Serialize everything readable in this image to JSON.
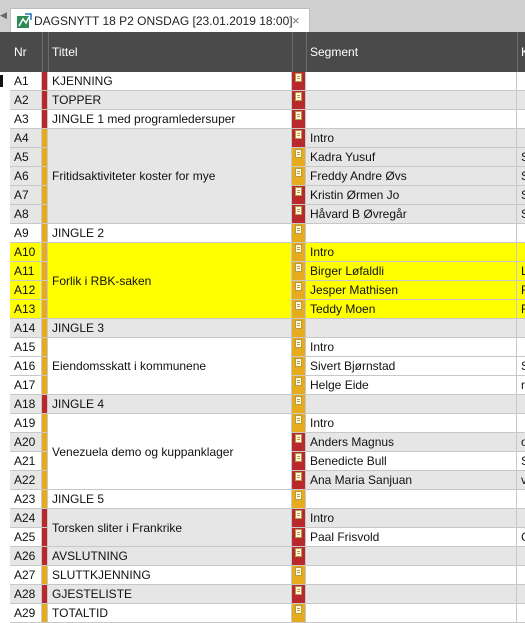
{
  "tab": {
    "title": "DAGSNYTT 18 P2 ONSDAG [23.01.2019 18:00]",
    "close": "×",
    "left_glyph": "◀"
  },
  "columns": {
    "nr": "Nr",
    "title": "Tittel",
    "segment": "Segment",
    "extra": "K"
  },
  "colors": {
    "red": "#b8282c",
    "yellow": "#e6ac1e",
    "highlight": "#ffff00",
    "header": "#4a4a4a",
    "alt": "#e6e6e6"
  },
  "rows": [
    {
      "nr": "A1",
      "title": "KJENNING",
      "segment": "",
      "ext": "",
      "bg": "#ffffff",
      "stripe": "#b8282c",
      "seg_stripe": "#b8282c"
    },
    {
      "nr": "A2",
      "title": "TOPPER",
      "segment": "",
      "ext": "",
      "bg": "#e6e6e6",
      "stripe": "#b8282c",
      "seg_stripe": "#b8282c"
    },
    {
      "nr": "A3",
      "title": "JINGLE 1 med programledersuper",
      "segment": "",
      "ext": "",
      "bg": "#ffffff",
      "stripe": "#b8282c",
      "seg_stripe": "#b8282c"
    },
    {
      "nr": "A4",
      "title": "",
      "segment": "Intro",
      "ext": "",
      "bg": "#e6e6e6",
      "stripe": "#e6ac1e",
      "seg_stripe": "#b8282c"
    },
    {
      "nr": "A5",
      "title": "",
      "segment": "Kadra Yusuf",
      "ext": "S",
      "bg": "#e6e6e6",
      "stripe": "#e6ac1e",
      "seg_stripe": "#e6ac1e"
    },
    {
      "nr": "A6",
      "title": "",
      "segment": "Freddy Andre Øvs",
      "ext": "S",
      "bg": "#e6e6e6",
      "stripe": "#e6ac1e",
      "seg_stripe": "#e6ac1e"
    },
    {
      "nr": "A7",
      "title": "",
      "segment": "Kristin Ørmen Jo",
      "ext": "S",
      "bg": "#e6e6e6",
      "stripe": "#e6ac1e",
      "seg_stripe": "#b8282c"
    },
    {
      "nr": "A8",
      "title": "",
      "segment": "Håvard B Øvregår",
      "ext": "S",
      "bg": "#e6e6e6",
      "stripe": "#e6ac1e",
      "seg_stripe": "#b8282c"
    },
    {
      "nr": "A9",
      "title": "JINGLE 2",
      "segment": "",
      "ext": "",
      "bg": "#ffffff",
      "stripe": "#e6ac1e",
      "seg_stripe": "#e6ac1e"
    },
    {
      "nr": "A10",
      "title": "",
      "segment": "Intro",
      "ext": "",
      "bg": "#ffff00",
      "stripe": "#e6ac1e",
      "seg_stripe": "#e6ac1e"
    },
    {
      "nr": "A11",
      "title": "",
      "segment": "Birger Løfaldli",
      "ext": "L",
      "bg": "#ffff00",
      "stripe": "#e6ac1e",
      "seg_stripe": "#e6ac1e"
    },
    {
      "nr": "A12",
      "title": "",
      "segment": "Jesper Mathisen",
      "ext": "R",
      "bg": "#ffff00",
      "stripe": "#e6ac1e",
      "seg_stripe": "#e6ac1e"
    },
    {
      "nr": "A13",
      "title": "",
      "segment": "Teddy Moen",
      "ext": "R",
      "bg": "#ffff00",
      "stripe": "#e6ac1e",
      "seg_stripe": "#e6ac1e"
    },
    {
      "nr": "A14",
      "title": "JINGLE 3",
      "segment": "",
      "ext": "",
      "bg": "#e6e6e6",
      "stripe": "#e6ac1e",
      "seg_stripe": "#e6ac1e"
    },
    {
      "nr": "A15",
      "title": "",
      "segment": "Intro",
      "ext": "",
      "bg": "#ffffff",
      "stripe": "#e6ac1e",
      "seg_stripe": "#e6ac1e"
    },
    {
      "nr": "A16",
      "title": "",
      "segment": "Sivert Bjørnstad",
      "ext": "S",
      "bg": "#ffffff",
      "stripe": "#e6ac1e",
      "seg_stripe": "#e6ac1e"
    },
    {
      "nr": "A17",
      "title": "",
      "segment": "Helge Eide",
      "ext": "re",
      "bg": "#ffffff",
      "stripe": "#e6ac1e",
      "seg_stripe": "#e6ac1e"
    },
    {
      "nr": "A18",
      "title": "JINGLE 4",
      "segment": "",
      "ext": "",
      "bg": "#e6e6e6",
      "stripe": "#b8282c",
      "seg_stripe": "#e6ac1e"
    },
    {
      "nr": "A19",
      "title": "",
      "segment": "Intro",
      "ext": "",
      "bg": "#ffffff",
      "stripe": "#e6ac1e",
      "seg_stripe": "#e6ac1e"
    },
    {
      "nr": "A20",
      "title": "",
      "segment": "Anders Magnus",
      "ext": "o",
      "bg": "#e6e6e6",
      "stripe": "#e6ac1e",
      "seg_stripe": "#b8282c"
    },
    {
      "nr": "A21",
      "title": "",
      "segment": "Benedicte Bull",
      "ext": "S",
      "bg": "#ffffff",
      "stripe": "#e6ac1e",
      "seg_stripe": "#b8282c"
    },
    {
      "nr": "A22",
      "title": "",
      "segment": "Ana Maria Sanjuan",
      "ext": "v",
      "bg": "#e6e6e6",
      "stripe": "#e6ac1e",
      "seg_stripe": "#b8282c"
    },
    {
      "nr": "A23",
      "title": "JINGLE 5",
      "segment": "",
      "ext": "",
      "bg": "#ffffff",
      "stripe": "#e6ac1e",
      "seg_stripe": "#e6ac1e"
    },
    {
      "nr": "A24",
      "title": "",
      "segment": "Intro",
      "ext": "",
      "bg": "#e6e6e6",
      "stripe": "#b8282c",
      "seg_stripe": "#b8282c"
    },
    {
      "nr": "A25",
      "title": "",
      "segment": "Paal Frisvold",
      "ext": "C",
      "bg": "#ffffff",
      "stripe": "#b8282c",
      "seg_stripe": "#b8282c"
    },
    {
      "nr": "A26",
      "title": "AVSLUTNING",
      "segment": "",
      "ext": "",
      "bg": "#e6e6e6",
      "stripe": "#b8282c",
      "seg_stripe": "#b8282c"
    },
    {
      "nr": "A27",
      "title": "SLUTTKJENNING",
      "segment": "",
      "ext": "",
      "bg": "#ffffff",
      "stripe": "#e6ac1e",
      "seg_stripe": "#e6ac1e"
    },
    {
      "nr": "A28",
      "title": "GJESTELISTE",
      "segment": "",
      "ext": "",
      "bg": "#e6e6e6",
      "stripe": "#b8282c",
      "seg_stripe": "#b8282c"
    },
    {
      "nr": "A29",
      "title": "TOTALTID",
      "segment": "",
      "ext": "",
      "bg": "#ffffff",
      "stripe": "#e6ac1e",
      "seg_stripe": "#e6ac1e"
    }
  ],
  "groups": [
    {
      "start": 3,
      "span": 5,
      "title": "Fritidsaktiviteter koster for mye",
      "bg": "#e6e6e6"
    },
    {
      "start": 9,
      "span": 4,
      "title": "Forlik i RBK-saken",
      "bg": "#ffff00"
    },
    {
      "start": 14,
      "span": 3,
      "title": "Eiendomsskatt i kommunene",
      "bg": "#ffffff"
    },
    {
      "start": 18,
      "span": 4,
      "title": "Venezuela demo og kuppanklager",
      "bg": "#ffffff"
    },
    {
      "start": 23,
      "span": 2,
      "title": "Torsken sliter i Frankrike",
      "bg": "#e6e6e6"
    }
  ]
}
